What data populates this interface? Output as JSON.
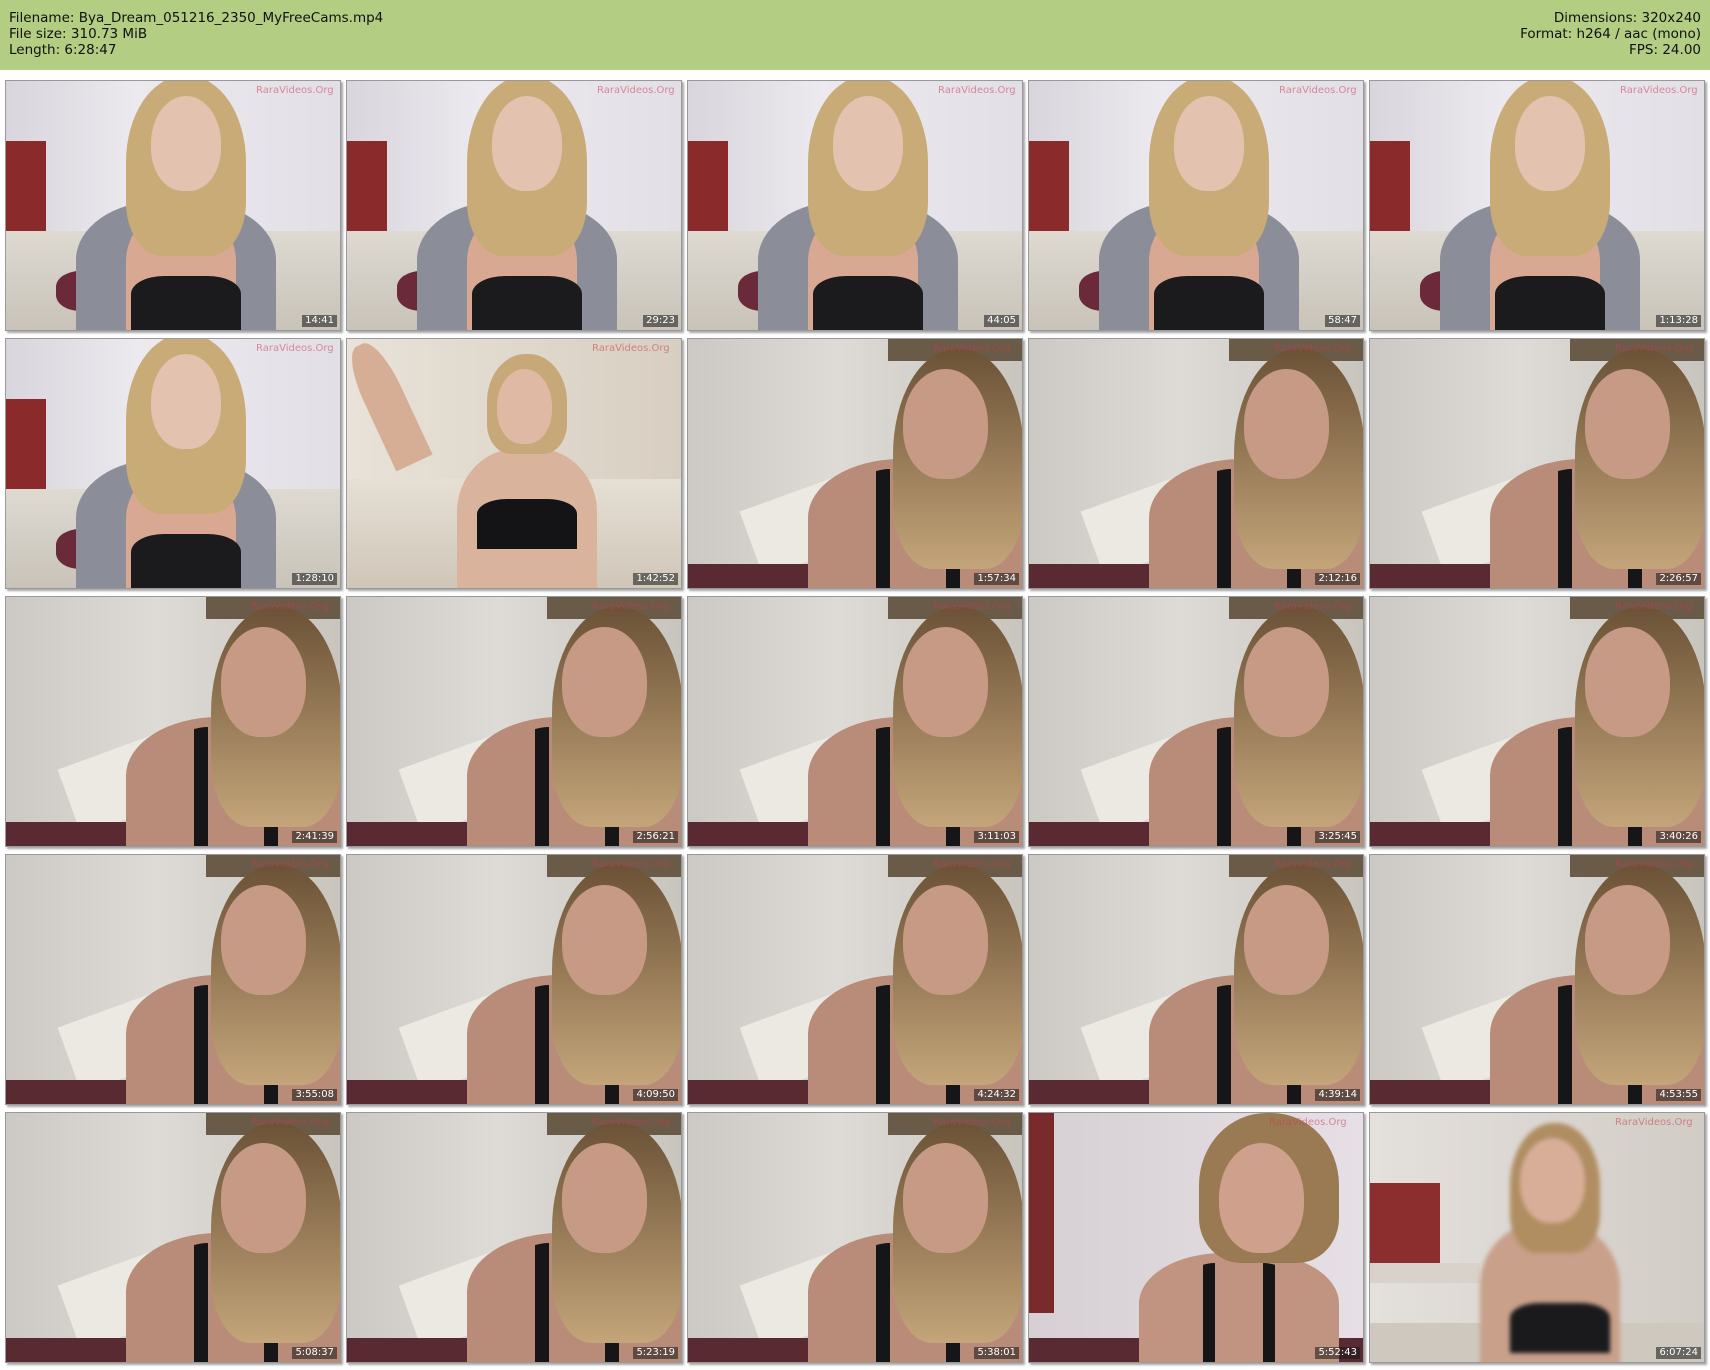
{
  "header": {
    "filename": "Filename: Bya_Dream_051216_2350_MyFreeCams.mp4",
    "filesize": "File size: 310.73 MiB",
    "length": "Length: 6:28:47",
    "dimensions": "Dimensions: 320x240",
    "format": "Format: h264 / aac (mono)",
    "fps": "FPS: 24.00"
  },
  "colors": {
    "header_bg": "#b3cd82"
  },
  "thumbnails": [
    {
      "timestamp": "14:41",
      "scene": "a"
    },
    {
      "timestamp": "29:23",
      "scene": "a"
    },
    {
      "timestamp": "44:05",
      "scene": "a"
    },
    {
      "timestamp": "58:47",
      "scene": "a"
    },
    {
      "timestamp": "1:13:28",
      "scene": "a"
    },
    {
      "timestamp": "1:28:10",
      "scene": "a"
    },
    {
      "timestamp": "1:42:52",
      "scene": "b"
    },
    {
      "timestamp": "1:57:34",
      "scene": "c"
    },
    {
      "timestamp": "2:12:16",
      "scene": "c"
    },
    {
      "timestamp": "2:26:57",
      "scene": "c"
    },
    {
      "timestamp": "2:41:39",
      "scene": "c"
    },
    {
      "timestamp": "2:56:21",
      "scene": "c"
    },
    {
      "timestamp": "3:11:03",
      "scene": "c"
    },
    {
      "timestamp": "3:25:45",
      "scene": "c"
    },
    {
      "timestamp": "3:40:26",
      "scene": "c"
    },
    {
      "timestamp": "3:55:08",
      "scene": "c"
    },
    {
      "timestamp": "4:09:50",
      "scene": "c"
    },
    {
      "timestamp": "4:24:32",
      "scene": "c"
    },
    {
      "timestamp": "4:39:14",
      "scene": "c"
    },
    {
      "timestamp": "4:53:55",
      "scene": "c"
    },
    {
      "timestamp": "5:08:37",
      "scene": "c"
    },
    {
      "timestamp": "5:23:19",
      "scene": "c"
    },
    {
      "timestamp": "5:38:01",
      "scene": "c"
    },
    {
      "timestamp": "5:52:43",
      "scene": "d"
    },
    {
      "timestamp": "6:07:24",
      "scene": "e"
    }
  ]
}
